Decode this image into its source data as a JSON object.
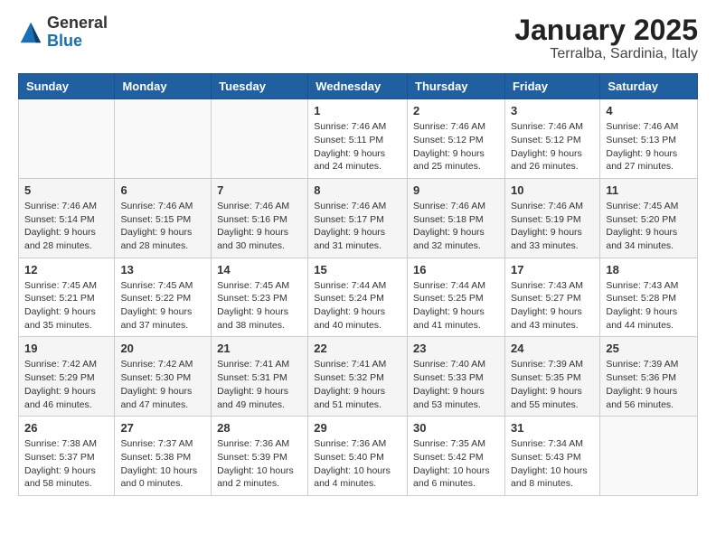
{
  "logo": {
    "general": "General",
    "blue": "Blue"
  },
  "title": "January 2025",
  "location": "Terralba, Sardinia, Italy",
  "days_of_week": [
    "Sunday",
    "Monday",
    "Tuesday",
    "Wednesday",
    "Thursday",
    "Friday",
    "Saturday"
  ],
  "weeks": [
    [
      {
        "day": "",
        "info": ""
      },
      {
        "day": "",
        "info": ""
      },
      {
        "day": "",
        "info": ""
      },
      {
        "day": "1",
        "info": "Sunrise: 7:46 AM\nSunset: 5:11 PM\nDaylight: 9 hours and 24 minutes."
      },
      {
        "day": "2",
        "info": "Sunrise: 7:46 AM\nSunset: 5:12 PM\nDaylight: 9 hours and 25 minutes."
      },
      {
        "day": "3",
        "info": "Sunrise: 7:46 AM\nSunset: 5:12 PM\nDaylight: 9 hours and 26 minutes."
      },
      {
        "day": "4",
        "info": "Sunrise: 7:46 AM\nSunset: 5:13 PM\nDaylight: 9 hours and 27 minutes."
      }
    ],
    [
      {
        "day": "5",
        "info": "Sunrise: 7:46 AM\nSunset: 5:14 PM\nDaylight: 9 hours and 28 minutes."
      },
      {
        "day": "6",
        "info": "Sunrise: 7:46 AM\nSunset: 5:15 PM\nDaylight: 9 hours and 28 minutes."
      },
      {
        "day": "7",
        "info": "Sunrise: 7:46 AM\nSunset: 5:16 PM\nDaylight: 9 hours and 30 minutes."
      },
      {
        "day": "8",
        "info": "Sunrise: 7:46 AM\nSunset: 5:17 PM\nDaylight: 9 hours and 31 minutes."
      },
      {
        "day": "9",
        "info": "Sunrise: 7:46 AM\nSunset: 5:18 PM\nDaylight: 9 hours and 32 minutes."
      },
      {
        "day": "10",
        "info": "Sunrise: 7:46 AM\nSunset: 5:19 PM\nDaylight: 9 hours and 33 minutes."
      },
      {
        "day": "11",
        "info": "Sunrise: 7:45 AM\nSunset: 5:20 PM\nDaylight: 9 hours and 34 minutes."
      }
    ],
    [
      {
        "day": "12",
        "info": "Sunrise: 7:45 AM\nSunset: 5:21 PM\nDaylight: 9 hours and 35 minutes."
      },
      {
        "day": "13",
        "info": "Sunrise: 7:45 AM\nSunset: 5:22 PM\nDaylight: 9 hours and 37 minutes."
      },
      {
        "day": "14",
        "info": "Sunrise: 7:45 AM\nSunset: 5:23 PM\nDaylight: 9 hours and 38 minutes."
      },
      {
        "day": "15",
        "info": "Sunrise: 7:44 AM\nSunset: 5:24 PM\nDaylight: 9 hours and 40 minutes."
      },
      {
        "day": "16",
        "info": "Sunrise: 7:44 AM\nSunset: 5:25 PM\nDaylight: 9 hours and 41 minutes."
      },
      {
        "day": "17",
        "info": "Sunrise: 7:43 AM\nSunset: 5:27 PM\nDaylight: 9 hours and 43 minutes."
      },
      {
        "day": "18",
        "info": "Sunrise: 7:43 AM\nSunset: 5:28 PM\nDaylight: 9 hours and 44 minutes."
      }
    ],
    [
      {
        "day": "19",
        "info": "Sunrise: 7:42 AM\nSunset: 5:29 PM\nDaylight: 9 hours and 46 minutes."
      },
      {
        "day": "20",
        "info": "Sunrise: 7:42 AM\nSunset: 5:30 PM\nDaylight: 9 hours and 47 minutes."
      },
      {
        "day": "21",
        "info": "Sunrise: 7:41 AM\nSunset: 5:31 PM\nDaylight: 9 hours and 49 minutes."
      },
      {
        "day": "22",
        "info": "Sunrise: 7:41 AM\nSunset: 5:32 PM\nDaylight: 9 hours and 51 minutes."
      },
      {
        "day": "23",
        "info": "Sunrise: 7:40 AM\nSunset: 5:33 PM\nDaylight: 9 hours and 53 minutes."
      },
      {
        "day": "24",
        "info": "Sunrise: 7:39 AM\nSunset: 5:35 PM\nDaylight: 9 hours and 55 minutes."
      },
      {
        "day": "25",
        "info": "Sunrise: 7:39 AM\nSunset: 5:36 PM\nDaylight: 9 hours and 56 minutes."
      }
    ],
    [
      {
        "day": "26",
        "info": "Sunrise: 7:38 AM\nSunset: 5:37 PM\nDaylight: 9 hours and 58 minutes."
      },
      {
        "day": "27",
        "info": "Sunrise: 7:37 AM\nSunset: 5:38 PM\nDaylight: 10 hours and 0 minutes."
      },
      {
        "day": "28",
        "info": "Sunrise: 7:36 AM\nSunset: 5:39 PM\nDaylight: 10 hours and 2 minutes."
      },
      {
        "day": "29",
        "info": "Sunrise: 7:36 AM\nSunset: 5:40 PM\nDaylight: 10 hours and 4 minutes."
      },
      {
        "day": "30",
        "info": "Sunrise: 7:35 AM\nSunset: 5:42 PM\nDaylight: 10 hours and 6 minutes."
      },
      {
        "day": "31",
        "info": "Sunrise: 7:34 AM\nSunset: 5:43 PM\nDaylight: 10 hours and 8 minutes."
      },
      {
        "day": "",
        "info": ""
      }
    ]
  ]
}
